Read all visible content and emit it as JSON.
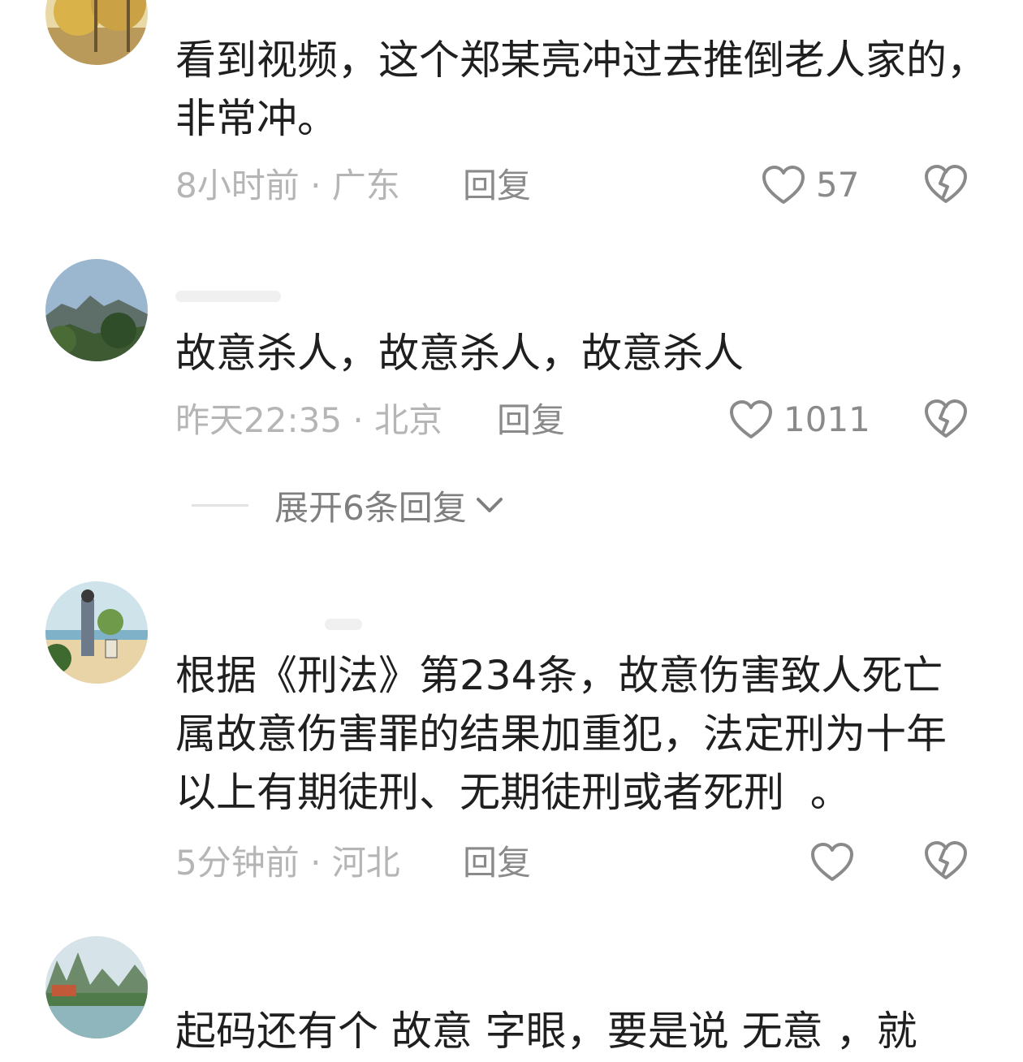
{
  "comments": [
    {
      "text": "看到视频，这个郑某亮冲过去推倒老人家的，\n非常冲。",
      "time": "8小时前",
      "location": "广东",
      "reply_label": "回复",
      "likes": "57"
    },
    {
      "text": "故意杀人，故意杀人，故意杀人",
      "time": "昨天22:35",
      "location": "北京",
      "reply_label": "回复",
      "likes": "1011",
      "expand_label": "展开6条回复"
    },
    {
      "text": "根据《刑法》第234条，故意伤害致人死亡\n属故意伤害罪的结果加重犯，法定刑为十年\n以上有期徒刑、无期徒刑或者死刑  。",
      "time": "5分钟前",
      "location": "河北",
      "reply_label": "回复",
      "likes": ""
    },
    {
      "text": "起码还有个 故意 字眼，要是说 无意 ，就"
    }
  ],
  "separator": " · ",
  "icons": {
    "like": "heart-outline-icon",
    "dislike": "broken-heart-icon",
    "expand": "chevron-down-icon"
  },
  "colors": {
    "text": "#1f1f1f",
    "meta": "#b5b5b5",
    "action": "#8a8a8a"
  }
}
